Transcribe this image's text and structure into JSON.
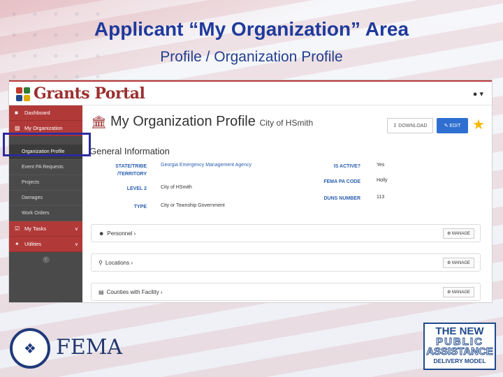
{
  "slide": {
    "title": "Applicant “My Organization” Area",
    "subtitle": "Profile / Organization Profile"
  },
  "app": {
    "logo_text": "Grants Portal",
    "user_menu_caret": "▾"
  },
  "sidebar": {
    "items": [
      {
        "label": "Dashboard",
        "icon": "dashboard-icon"
      },
      {
        "label": "My Organization",
        "icon": "org-icon"
      }
    ],
    "sub_items": [
      {
        "label": "Organization Profile"
      },
      {
        "label": "Event PA Requests"
      },
      {
        "label": "Projects"
      },
      {
        "label": "Damages"
      },
      {
        "label": "Work Orders"
      }
    ],
    "footer_items": [
      {
        "label": "My Tasks",
        "icon": "check-icon"
      },
      {
        "label": "Utilities",
        "icon": "wrench-icon"
      }
    ]
  },
  "header": {
    "title": "My Organization Profile",
    "subtitle": "City of HSmith",
    "download_label": "DOWNLOAD",
    "edit_label": "EDIT"
  },
  "general_info": {
    "section_title": "General Information",
    "state_label": "STATE/TRIBE /TERRITORY",
    "state_value": "Georgia Emergency Management Agency",
    "level2_label": "LEVEL 2",
    "level2_value": "City of HSmith",
    "type_label": "TYPE",
    "type_value": "City or Township Government",
    "active_label": "IS ACTIVE?",
    "active_value": "Yes",
    "pa_code_label": "FEMA PA CODE",
    "pa_code_value": "Holly",
    "duns_label": "DUNS NUMBER",
    "duns_value": "113"
  },
  "panels": [
    {
      "label": "Personnel",
      "icon": "users-icon",
      "button": "MANAGE"
    },
    {
      "label": "Locations",
      "icon": "map-marker-icon",
      "button": "MANAGE"
    },
    {
      "label": "Counties with Facility",
      "icon": "map-icon",
      "button": "MANAGE"
    }
  ],
  "footer": {
    "fema_text": "FEMA",
    "pa_logo": [
      "THE NEW",
      "PUBLIC",
      "ASSISTANCE",
      "DELIVERY MODEL"
    ]
  },
  "colors": {
    "title_blue": "#1f3a9c",
    "portal_red": "#b13a38",
    "edit_blue": "#2f6fd1",
    "highlight": "#2c2c9c"
  }
}
